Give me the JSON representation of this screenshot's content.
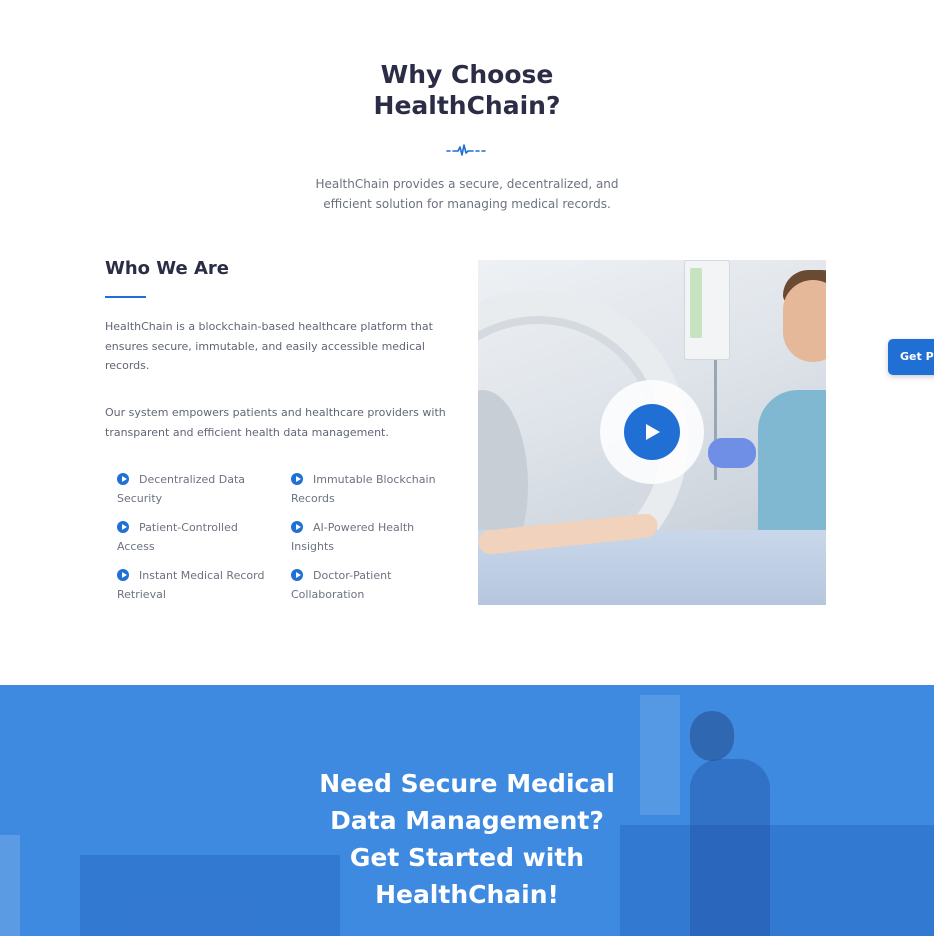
{
  "section": {
    "title_line1": "Why Choose",
    "title_line2": "HealthChain?",
    "description": "HealthChain provides a secure, decentralized, and efficient solution for managing medical records."
  },
  "about": {
    "heading": "Who We Are",
    "paragraph1": "HealthChain is a blockchain-based healthcare platform that ensures secure, immutable, and easily accessible medical records.",
    "paragraph2": "Our system empowers patients and healthcare providers with transparent and efficient health data management.",
    "features": [
      {
        "label": "Decentralized Data Security",
        "icon": "play-circle-icon"
      },
      {
        "label": "Immutable Blockchain Records",
        "icon": "play-circle-icon"
      },
      {
        "label": "Patient-Controlled Access",
        "icon": "play-circle-icon"
      },
      {
        "label": "AI-Powered Health Insights",
        "icon": "play-circle-icon"
      },
      {
        "label": "Instant Medical Record Retrieval",
        "icon": "play-circle-icon"
      },
      {
        "label": "Doctor-Patient Collaboration",
        "icon": "play-circle-icon"
      }
    ]
  },
  "video": {
    "play_icon": "play-icon"
  },
  "side_cta": {
    "label": "Get Pr"
  },
  "cta_banner": {
    "line1": "Need Secure Medical",
    "line2": "Data Management?",
    "line3": "Get Started with",
    "line4": "HealthChain!"
  },
  "colors": {
    "accent": "#1f6fd4",
    "heading": "#2a2d45",
    "body_text": "#6c7280",
    "banner": "#3e8ae0"
  }
}
